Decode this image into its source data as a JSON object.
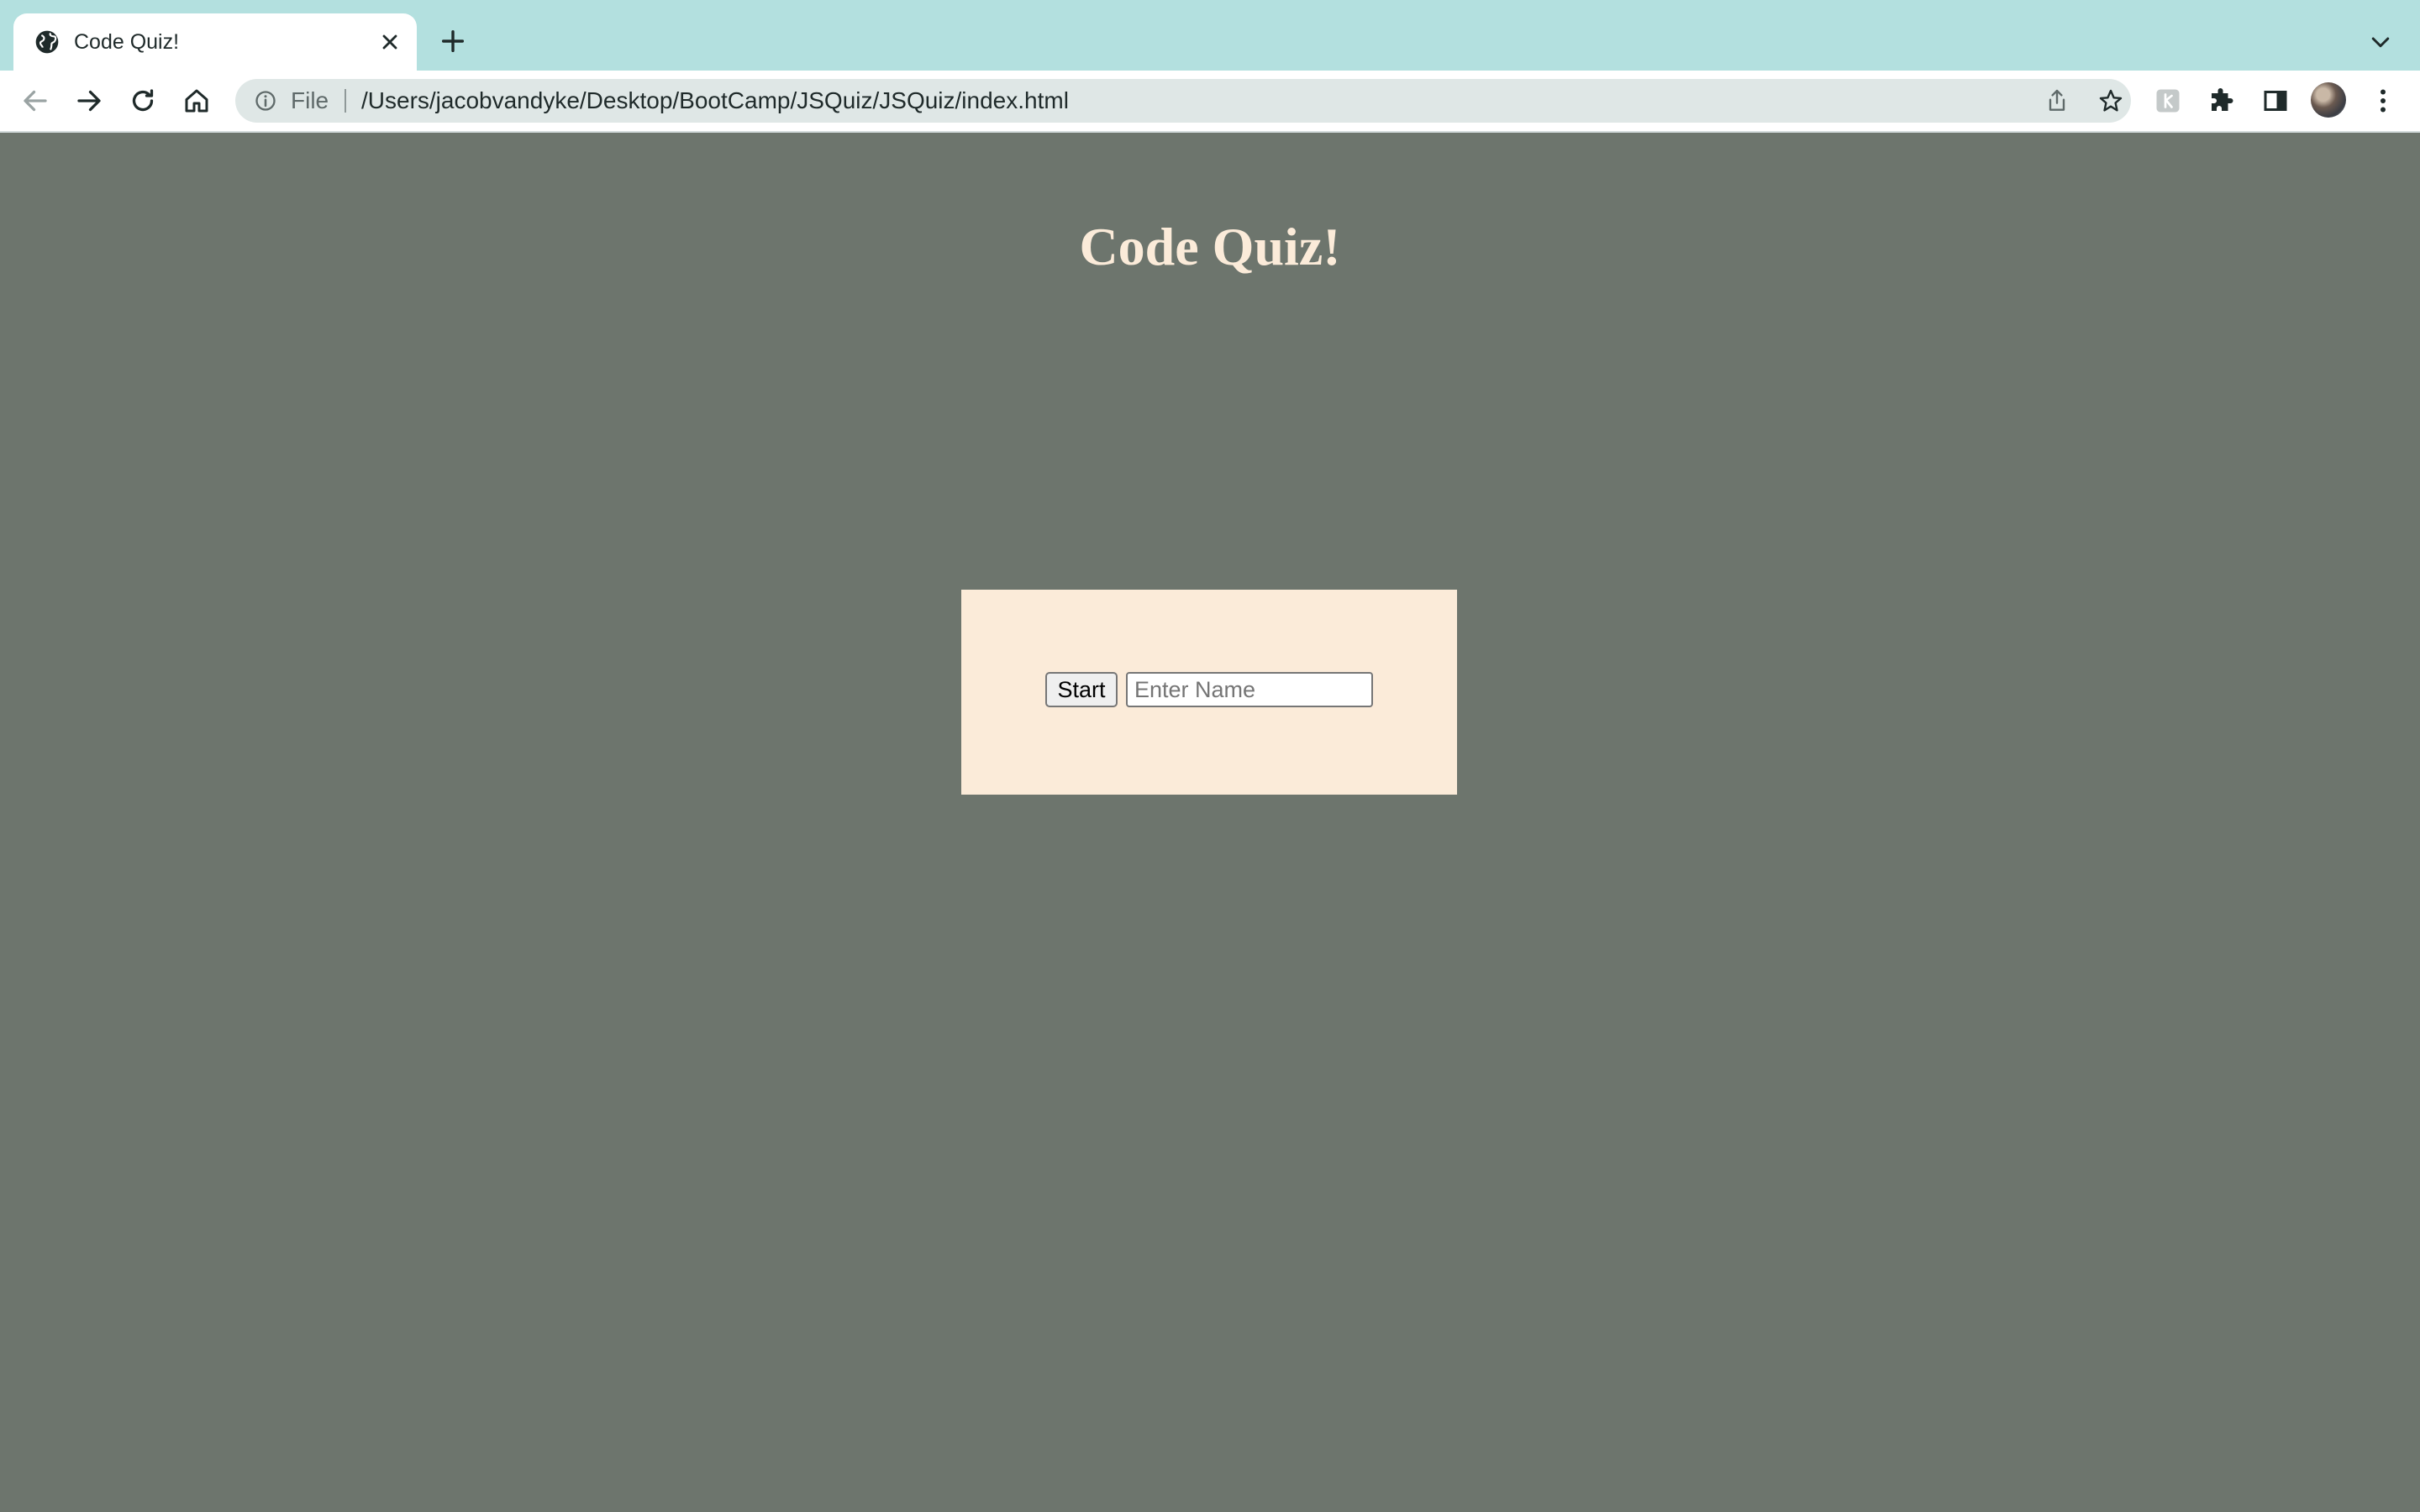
{
  "browser": {
    "tab": {
      "title": "Code Quiz!"
    },
    "address_bar": {
      "scheme_label": "File",
      "url": "/Users/jacobvandyke/Desktop/BootCamp/JSQuiz/JSQuiz/index.html"
    },
    "icons": {
      "favicon": "globe-icon",
      "close": "close-icon",
      "new_tab": "plus-icon",
      "tab_search": "chevron-down-icon",
      "back": "back-arrow-icon",
      "forward": "forward-arrow-icon",
      "reload": "reload-icon",
      "home": "home-icon",
      "site_info": "info-icon",
      "share": "share-icon",
      "bookmark": "star-icon",
      "extension": "extension-app-icon",
      "extensions_menu": "puzzle-icon",
      "side_panel": "side-panel-icon",
      "profile": "avatar",
      "menu": "kebab-menu-icon"
    },
    "colors": {
      "tabstrip": "#b3e0df",
      "toolbar": "#ffffff",
      "omnibox": "#dfe7e6"
    }
  },
  "page": {
    "title": "Code Quiz!",
    "start_button_label": "Start",
    "name_input": {
      "placeholder": "Enter Name",
      "value": ""
    },
    "colors": {
      "background": "#6d756d",
      "title": "#fbebd9",
      "card": "#fbebd9"
    }
  }
}
